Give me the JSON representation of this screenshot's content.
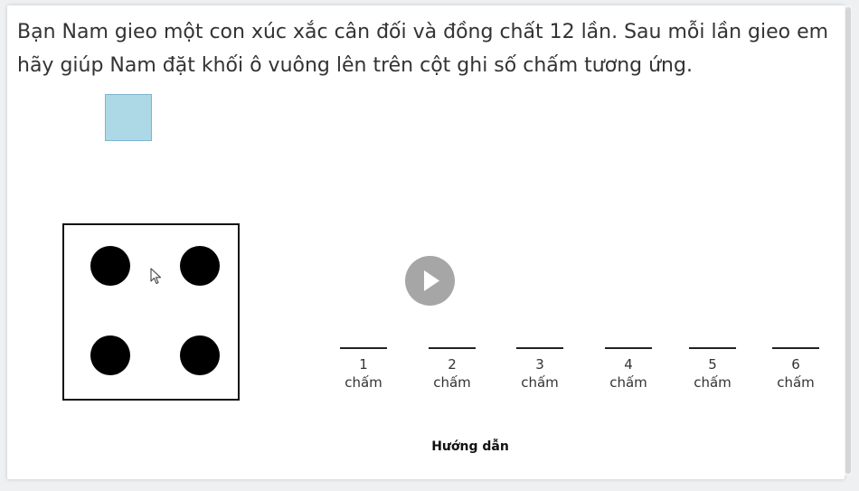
{
  "question": {
    "line1": "Bạn Nam gieo một con xúc xắc cân đối và đồng chất 12 lần. Sau mỗi lần gieo em",
    "line2": "hãy giúp Nam đặt khối ô vuông lên trên cột ghi số chấm tương ứng."
  },
  "block": {
    "color": "#add8e6"
  },
  "die": {
    "face_value": 4,
    "pip_color": "#000000"
  },
  "play_button": {
    "icon": "play-icon",
    "color": "#a6a6a6"
  },
  "columns": [
    {
      "number": "1",
      "unit": "chấm"
    },
    {
      "number": "2",
      "unit": "chấm"
    },
    {
      "number": "3",
      "unit": "chấm"
    },
    {
      "number": "4",
      "unit": "chấm"
    },
    {
      "number": "5",
      "unit": "chấm"
    },
    {
      "number": "6",
      "unit": "chấm"
    }
  ],
  "guide": {
    "label": "Hướng dẫn"
  }
}
